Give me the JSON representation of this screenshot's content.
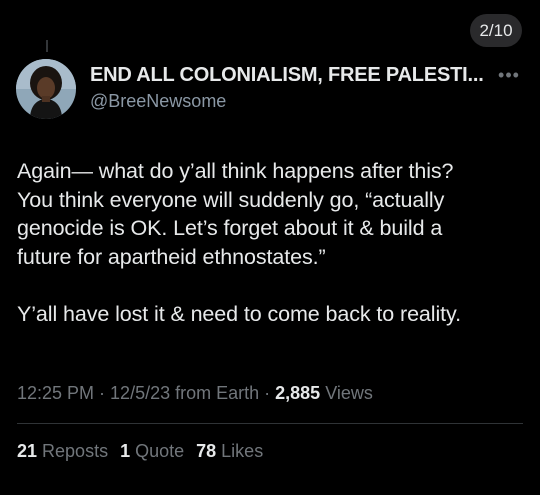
{
  "thread": {
    "position": "2/10"
  },
  "author": {
    "display_name": "END ALL COLONIALISM, FREE PALESTI...",
    "handle": "@BreeNewsome",
    "avatar_icon": "profile-photo"
  },
  "tweet": {
    "lines": [
      "Again— what do y’all think happens after this?",
      "You think everyone will suddenly go, “actually",
      "genocide is OK. Let’s forget about it & build a",
      "future for apartheid ethnostates.”",
      "Y’all have lost it & need to come back to reality."
    ],
    "time": "12:25 PM",
    "sep1": " · ",
    "date": "12/5/23 from Earth",
    "sep2": " · ",
    "views_count": "2,885",
    "views_label": " Views"
  },
  "stats": {
    "reposts_count": "21",
    "reposts_label": " Reposts",
    "quotes_count": "1",
    "quotes_label": " Quote",
    "likes_count": "78",
    "likes_label": " Likes"
  },
  "colors": {
    "background": "#000000",
    "text": "#e7e9ea",
    "secondary": "#71767b",
    "divider": "#2f3336"
  },
  "icons": {
    "more": "more-horizontal-icon"
  }
}
